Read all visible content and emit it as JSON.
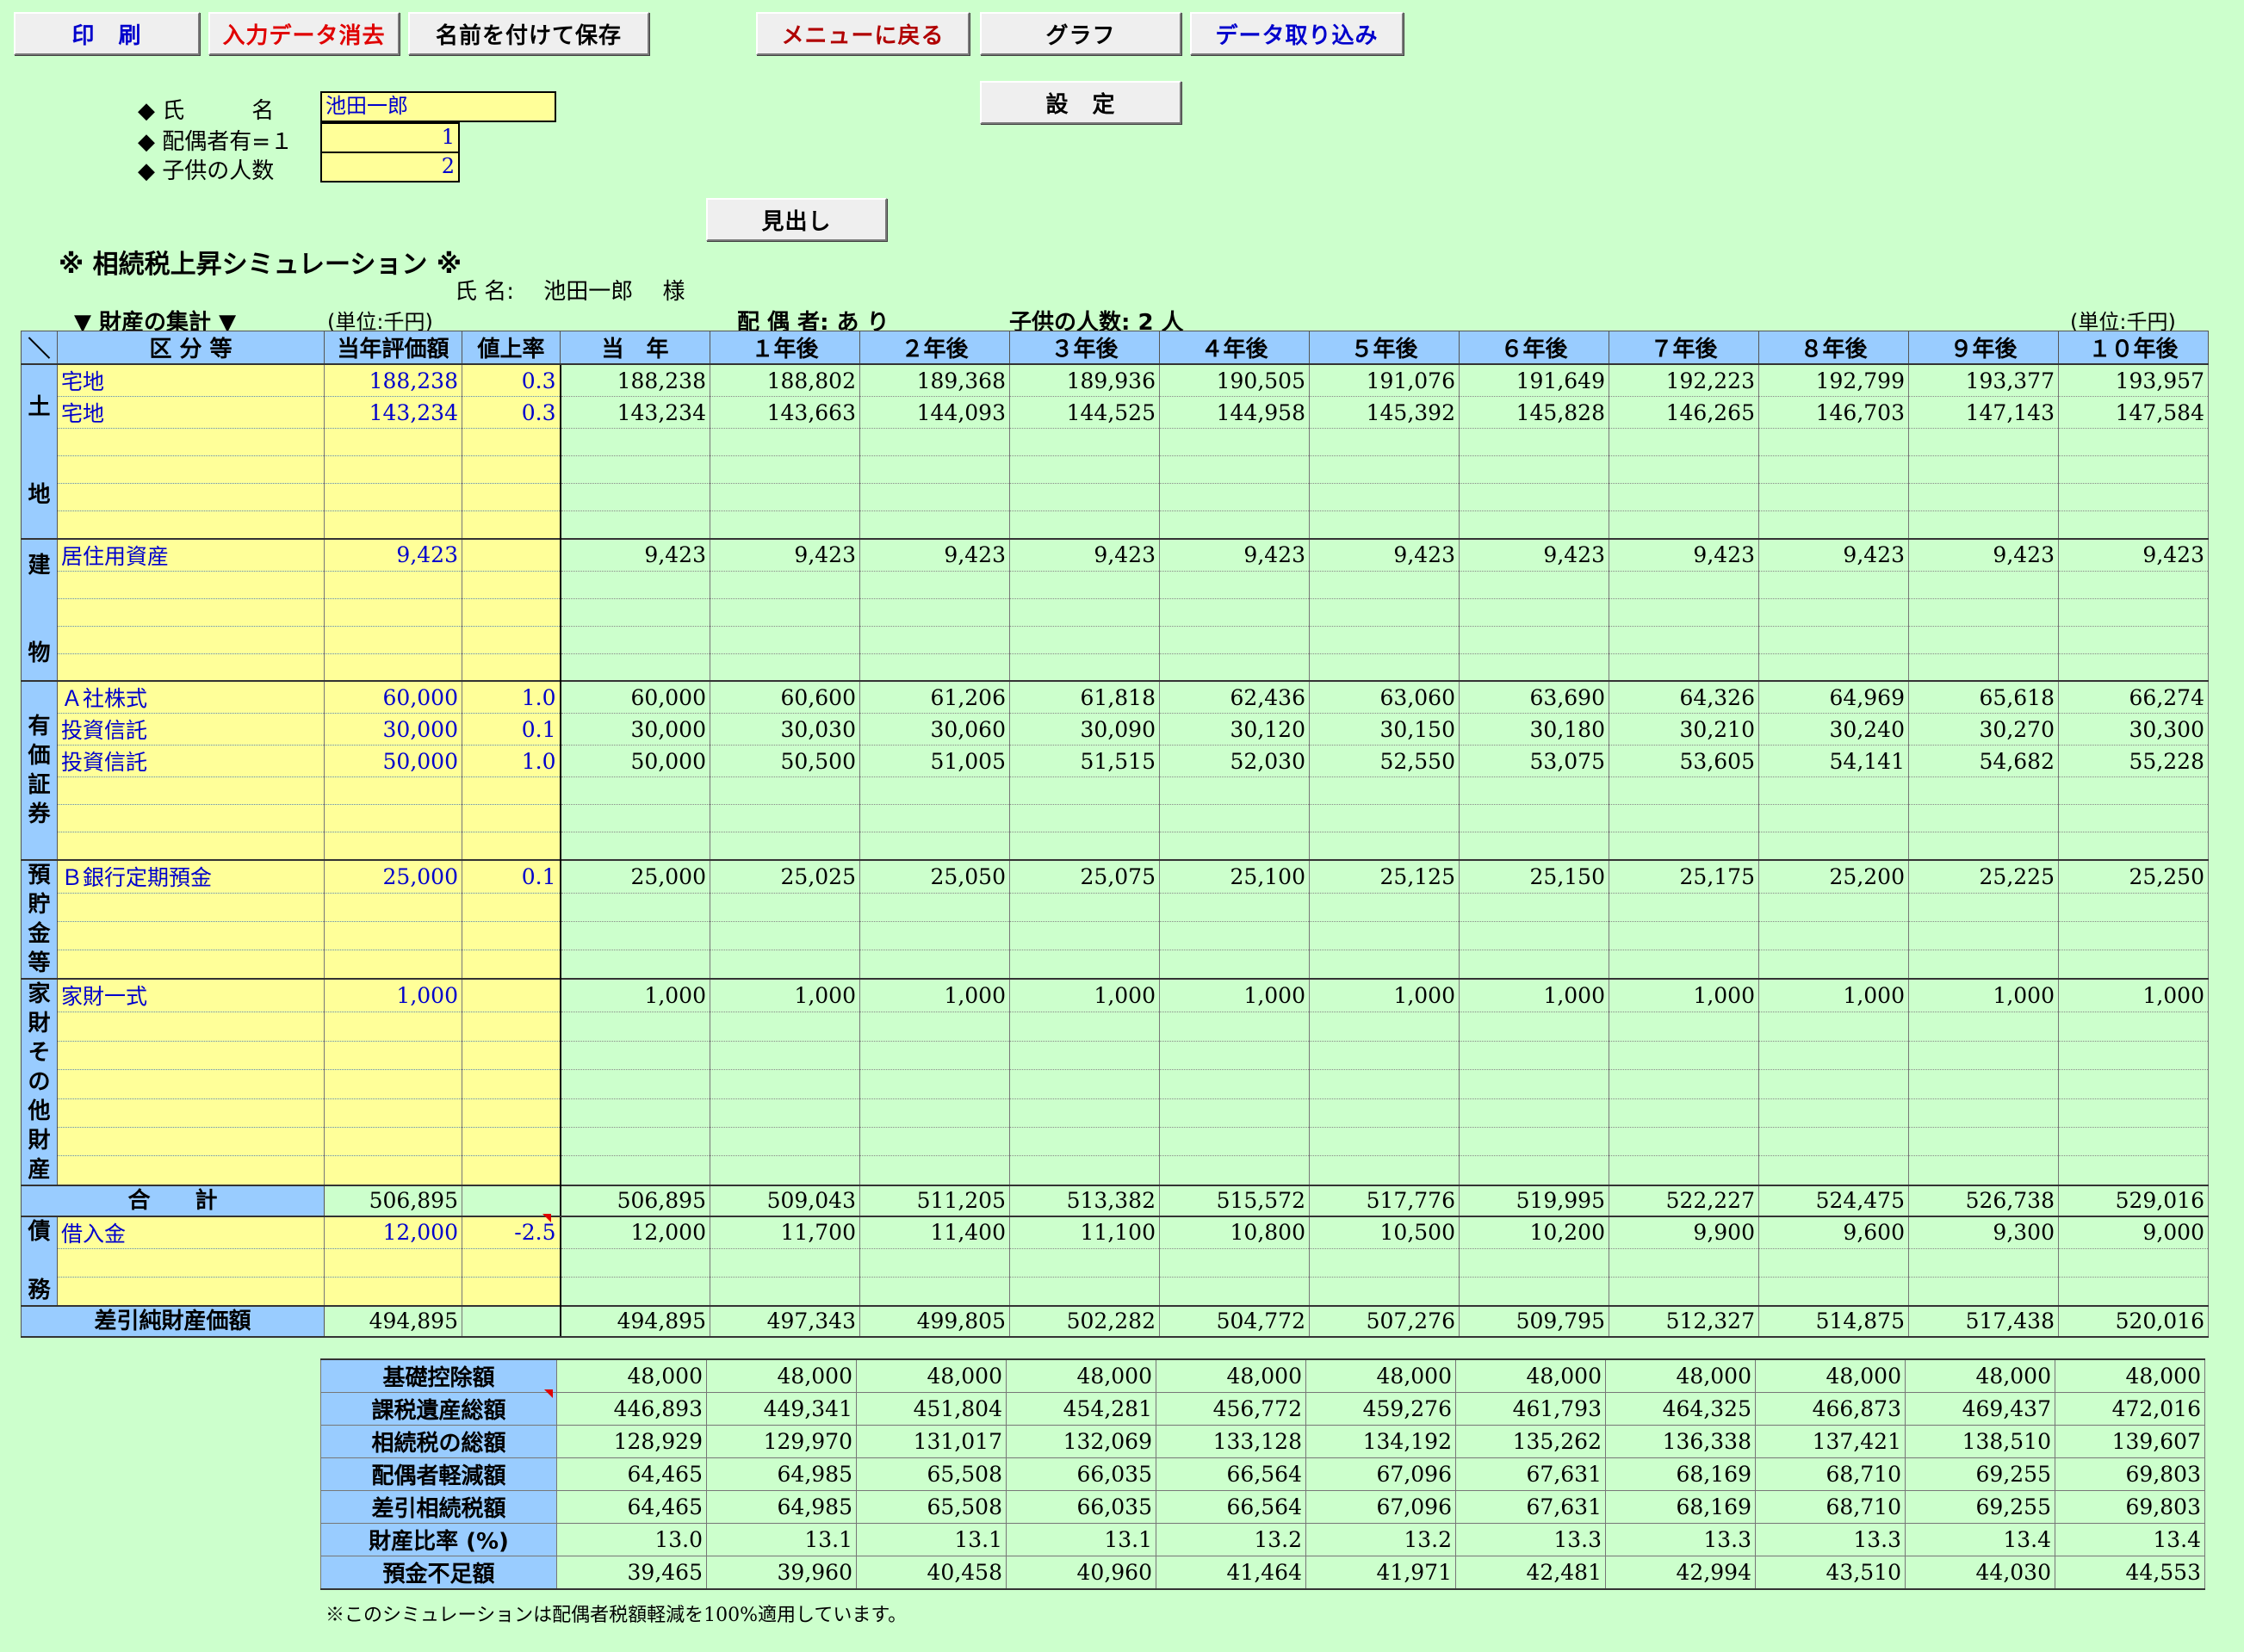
{
  "toolbar": {
    "print": "印　刷",
    "clear": "入力データ消去",
    "save_as": "名前を付けて保存",
    "menu": "メニューに戻る",
    "graph": "グラフ",
    "import": "データ取り込み",
    "settings": "設　定",
    "heading_btn": "見出し"
  },
  "inputs": {
    "name_label": "◆ 氏　　　名",
    "name_value": "池田一郎",
    "spouse_label": "◆ 配偶者有=１",
    "spouse_value": "1",
    "children_label": "◆ 子供の人数",
    "children_value": "2"
  },
  "report": {
    "title": "※ 相続税上昇シミュレーション ※",
    "name_line": "氏 名:　 池田一郎　 様",
    "section_label": "▼ 財産の集計 ▼",
    "unit_left": "(単位:千円)",
    "spouse_line": "配 偶 者: あ り",
    "children_line": "子供の人数: 2 人",
    "unit_right": "(単位:千円)",
    "footnote": "※このシミュレーションは配偶者税額軽減を100%適用しています。"
  },
  "table": {
    "headers": [
      "＼",
      "区 分 等",
      "当年評価額",
      "値上率",
      "当　年",
      "１年後",
      "２年後",
      "３年後",
      "４年後",
      "５年後",
      "６年後",
      "７年後",
      "８年後",
      "９年後",
      "１０年後"
    ],
    "groups": [
      {
        "category": "土\n\n\n地",
        "rows": [
          {
            "name": "宅地",
            "value": "188,238",
            "rate": "0.3",
            "years": [
              "188,238",
              "188,802",
              "189,368",
              "189,936",
              "190,505",
              "191,076",
              "191,649",
              "192,223",
              "192,799",
              "193,377",
              "193,957"
            ]
          },
          {
            "name": "宅地",
            "value": "143,234",
            "rate": "0.3",
            "years": [
              "143,234",
              "143,663",
              "144,093",
              "144,525",
              "144,958",
              "145,392",
              "145,828",
              "146,265",
              "146,703",
              "147,143",
              "147,584"
            ]
          },
          {
            "name": "",
            "value": "",
            "rate": "",
            "years": []
          },
          {
            "name": "",
            "value": "",
            "rate": "",
            "years": []
          },
          {
            "name": "",
            "value": "",
            "rate": "",
            "years": []
          },
          {
            "name": "",
            "value": "",
            "rate": "",
            "years": []
          }
        ]
      },
      {
        "category": "建\n\n\n物",
        "rows": [
          {
            "name": "居住用資産",
            "value": "9,423",
            "rate": "",
            "years": [
              "9,423",
              "9,423",
              "9,423",
              "9,423",
              "9,423",
              "9,423",
              "9,423",
              "9,423",
              "9,423",
              "9,423",
              "9,423"
            ]
          },
          {
            "name": "",
            "value": "",
            "rate": "",
            "years": []
          },
          {
            "name": "",
            "value": "",
            "rate": "",
            "years": []
          },
          {
            "name": "",
            "value": "",
            "rate": "",
            "years": []
          },
          {
            "name": "",
            "value": "",
            "rate": "",
            "years": []
          }
        ]
      },
      {
        "category": "有\n価\n証\n券",
        "rows": [
          {
            "name": "Ａ社株式",
            "value": "60,000",
            "rate": "1.0",
            "years": [
              "60,000",
              "60,600",
              "61,206",
              "61,818",
              "62,436",
              "63,060",
              "63,690",
              "64,326",
              "64,969",
              "65,618",
              "66,274"
            ]
          },
          {
            "name": "投資信託",
            "value": "30,000",
            "rate": "0.1",
            "years": [
              "30,000",
              "30,030",
              "30,060",
              "30,090",
              "30,120",
              "30,150",
              "30,180",
              "30,210",
              "30,240",
              "30,270",
              "30,300"
            ]
          },
          {
            "name": "投資信託",
            "value": "50,000",
            "rate": "1.0",
            "years": [
              "50,000",
              "50,500",
              "51,005",
              "51,515",
              "52,030",
              "52,550",
              "53,075",
              "53,605",
              "54,141",
              "54,682",
              "55,228"
            ]
          },
          {
            "name": "",
            "value": "",
            "rate": "",
            "years": []
          },
          {
            "name": "",
            "value": "",
            "rate": "",
            "years": []
          },
          {
            "name": "",
            "value": "",
            "rate": "",
            "years": []
          }
        ]
      },
      {
        "category": "預\n貯\n金\n等",
        "rows": [
          {
            "name": "Ｂ銀行定期預金",
            "value": "25,000",
            "rate": "0.1",
            "years": [
              "25,000",
              "25,025",
              "25,050",
              "25,075",
              "25,100",
              "25,125",
              "25,150",
              "25,175",
              "25,200",
              "25,225",
              "25,250"
            ]
          },
          {
            "name": "",
            "value": "",
            "rate": "",
            "years": []
          },
          {
            "name": "",
            "value": "",
            "rate": "",
            "years": []
          },
          {
            "name": "",
            "value": "",
            "rate": "",
            "years": []
          }
        ]
      },
      {
        "category": "家\n財\nそ\nの\n他\n財\n産",
        "rows": [
          {
            "name": "家財一式",
            "value": "1,000",
            "rate": "",
            "years": [
              "1,000",
              "1,000",
              "1,000",
              "1,000",
              "1,000",
              "1,000",
              "1,000",
              "1,000",
              "1,000",
              "1,000",
              "1,000"
            ]
          },
          {
            "name": "",
            "value": "",
            "rate": "",
            "years": []
          },
          {
            "name": "",
            "value": "",
            "rate": "",
            "years": []
          },
          {
            "name": "",
            "value": "",
            "rate": "",
            "years": []
          },
          {
            "name": "",
            "value": "",
            "rate": "",
            "years": []
          },
          {
            "name": "",
            "value": "",
            "rate": "",
            "years": []
          },
          {
            "name": "",
            "value": "",
            "rate": "",
            "years": []
          }
        ]
      }
    ],
    "total": {
      "label": "合　　計",
      "value": "506,895",
      "years": [
        "506,895",
        "509,043",
        "511,205",
        "513,382",
        "515,572",
        "517,776",
        "519,995",
        "522,227",
        "524,475",
        "526,738",
        "529,016"
      ]
    },
    "debt": {
      "category": "債\n\n務",
      "rows": [
        {
          "name": "借入金",
          "value": "12,000",
          "rate": "-2.5",
          "years": [
            "12,000",
            "11,700",
            "11,400",
            "11,100",
            "10,800",
            "10,500",
            "10,200",
            "9,900",
            "9,600",
            "9,300",
            "9,000"
          ]
        },
        {
          "name": "",
          "value": "",
          "rate": "",
          "years": []
        },
        {
          "name": "",
          "value": "",
          "rate": "",
          "years": []
        }
      ]
    },
    "net": {
      "label": "差引純財産価額",
      "value": "494,895",
      "years": [
        "494,895",
        "497,343",
        "499,805",
        "502,282",
        "504,772",
        "507,276",
        "509,795",
        "512,327",
        "514,875",
        "517,438",
        "520,016"
      ]
    }
  },
  "tax": {
    "rows": [
      {
        "label": "基礎控除額",
        "values": [
          "48,000",
          "48,000",
          "48,000",
          "48,000",
          "48,000",
          "48,000",
          "48,000",
          "48,000",
          "48,000",
          "48,000",
          "48,000"
        ]
      },
      {
        "label": "課税遺産総額",
        "values": [
          "446,893",
          "449,341",
          "451,804",
          "454,281",
          "456,772",
          "459,276",
          "461,793",
          "464,325",
          "466,873",
          "469,437",
          "472,016"
        ]
      },
      {
        "label": "相続税の総額",
        "values": [
          "128,929",
          "129,970",
          "131,017",
          "132,069",
          "133,128",
          "134,192",
          "135,262",
          "136,338",
          "137,421",
          "138,510",
          "139,607"
        ]
      },
      {
        "label": "配偶者軽減額",
        "values": [
          "64,465",
          "64,985",
          "65,508",
          "66,035",
          "66,564",
          "67,096",
          "67,631",
          "68,169",
          "68,710",
          "69,255",
          "69,803"
        ]
      },
      {
        "label": "差引相続税額",
        "values": [
          "64,465",
          "64,985",
          "65,508",
          "66,035",
          "66,564",
          "67,096",
          "67,631",
          "68,169",
          "68,710",
          "69,255",
          "69,803"
        ]
      },
      {
        "label": "財産比率 (%)",
        "values": [
          "13.0",
          "13.1",
          "13.1",
          "13.1",
          "13.2",
          "13.2",
          "13.3",
          "13.3",
          "13.3",
          "13.4",
          "13.4"
        ]
      },
      {
        "label": "預金不足額",
        "values": [
          "39,465",
          "39,960",
          "40,458",
          "40,960",
          "41,464",
          "41,971",
          "42,481",
          "42,994",
          "43,510",
          "44,030",
          "44,553"
        ]
      }
    ]
  },
  "colors": {
    "background": "#ccffcc",
    "input": "#ffff99",
    "header": "#99ccff",
    "value_text": "#0000cc"
  }
}
